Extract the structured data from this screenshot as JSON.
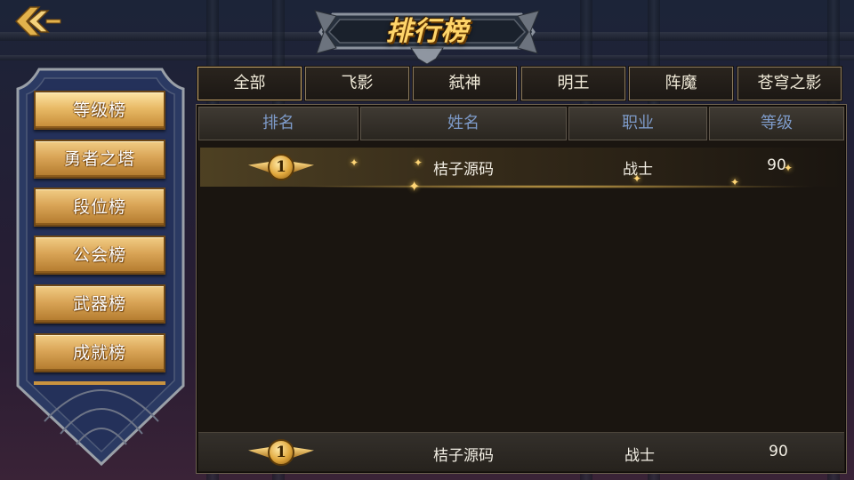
{
  "title": "排行榜",
  "side_menu": [
    {
      "label": "等级榜",
      "active": true
    },
    {
      "label": "勇者之塔",
      "active": false
    },
    {
      "label": "段位榜",
      "active": false
    },
    {
      "label": "公会榜",
      "active": false
    },
    {
      "label": "武器榜",
      "active": false
    },
    {
      "label": "成就榜",
      "active": false
    }
  ],
  "tabs": [
    {
      "label": "全部",
      "active": true
    },
    {
      "label": "飞影",
      "active": false
    },
    {
      "label": "弑神",
      "active": false
    },
    {
      "label": "明王",
      "active": false
    },
    {
      "label": "阵魔",
      "active": false
    },
    {
      "label": "苍穹之影",
      "active": false
    }
  ],
  "table": {
    "headers": [
      "排名",
      "姓名",
      "职业",
      "等级"
    ],
    "rows": [
      {
        "rank": "1",
        "name": "桔子源码",
        "class": "战士",
        "level": "90"
      }
    ],
    "my_row": {
      "rank": "1",
      "name": "桔子源码",
      "class": "战士",
      "level": "90"
    }
  },
  "icons": {
    "back": "back-arrow-icon",
    "medal": "rank-medal-icon"
  },
  "colors": {
    "gold": "#ffd56a",
    "header_text": "#7d9ac8",
    "panel_blue": "#2c3b66"
  }
}
